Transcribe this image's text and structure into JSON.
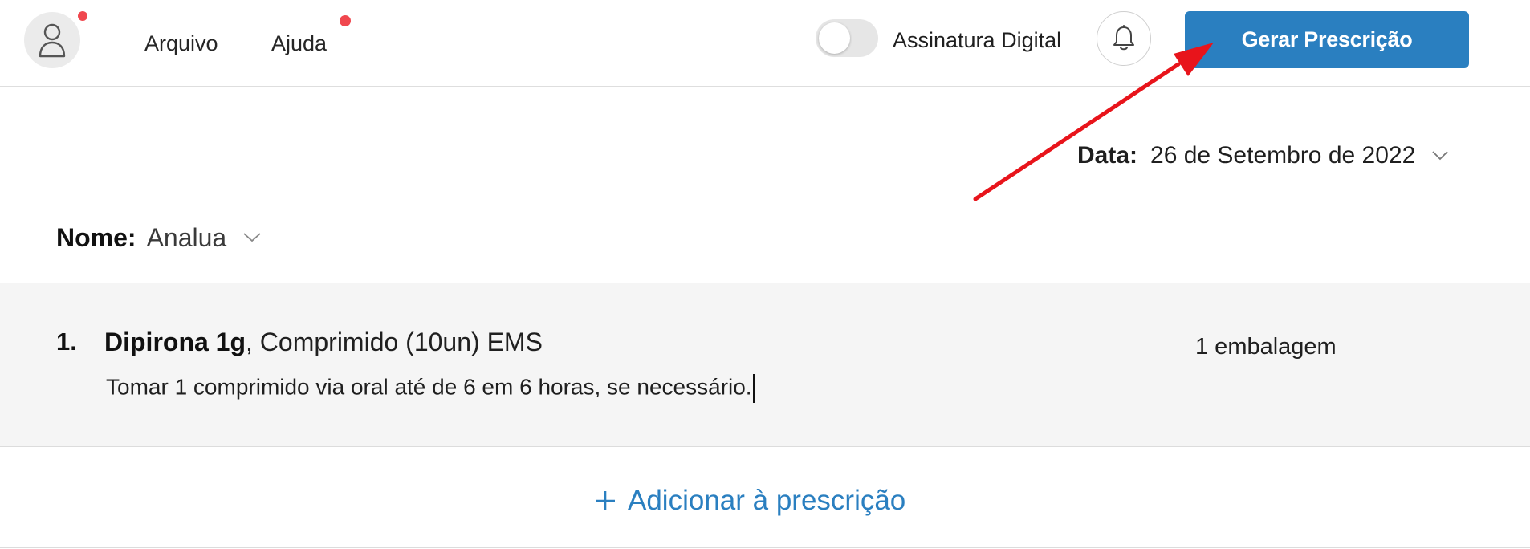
{
  "header": {
    "menu": [
      {
        "label": "Arquivo"
      },
      {
        "label": "Ajuda"
      }
    ],
    "signature_toggle": {
      "label": "Assinatura Digital",
      "on": false
    },
    "primary_button": "Gerar Prescrição"
  },
  "form": {
    "date": {
      "label": "Data:",
      "value": "26 de Setembro de 2022"
    },
    "name": {
      "label": "Nome:",
      "value": "Analua"
    }
  },
  "prescriptions": [
    {
      "number": "1.",
      "drug": "Dipirona 1g",
      "details": ", Comprimido (10un) EMS",
      "quantity": "1 embalagem",
      "instructions": "Tomar 1 comprimido via oral até de 6 em 6 horas, se necessário."
    }
  ],
  "add_item_label": "Adicionar à prescrição",
  "icons": {
    "avatar": "user-icon",
    "bell": "bell-icon",
    "chevron": "chevron-down-icon",
    "add": "plus-icon",
    "annotation": "red-arrow"
  },
  "colors": {
    "accent": "#2a7fc0",
    "notification_dot": "#f0474e",
    "annotation_arrow": "#e8141b",
    "row_background": "#f5f5f5"
  }
}
